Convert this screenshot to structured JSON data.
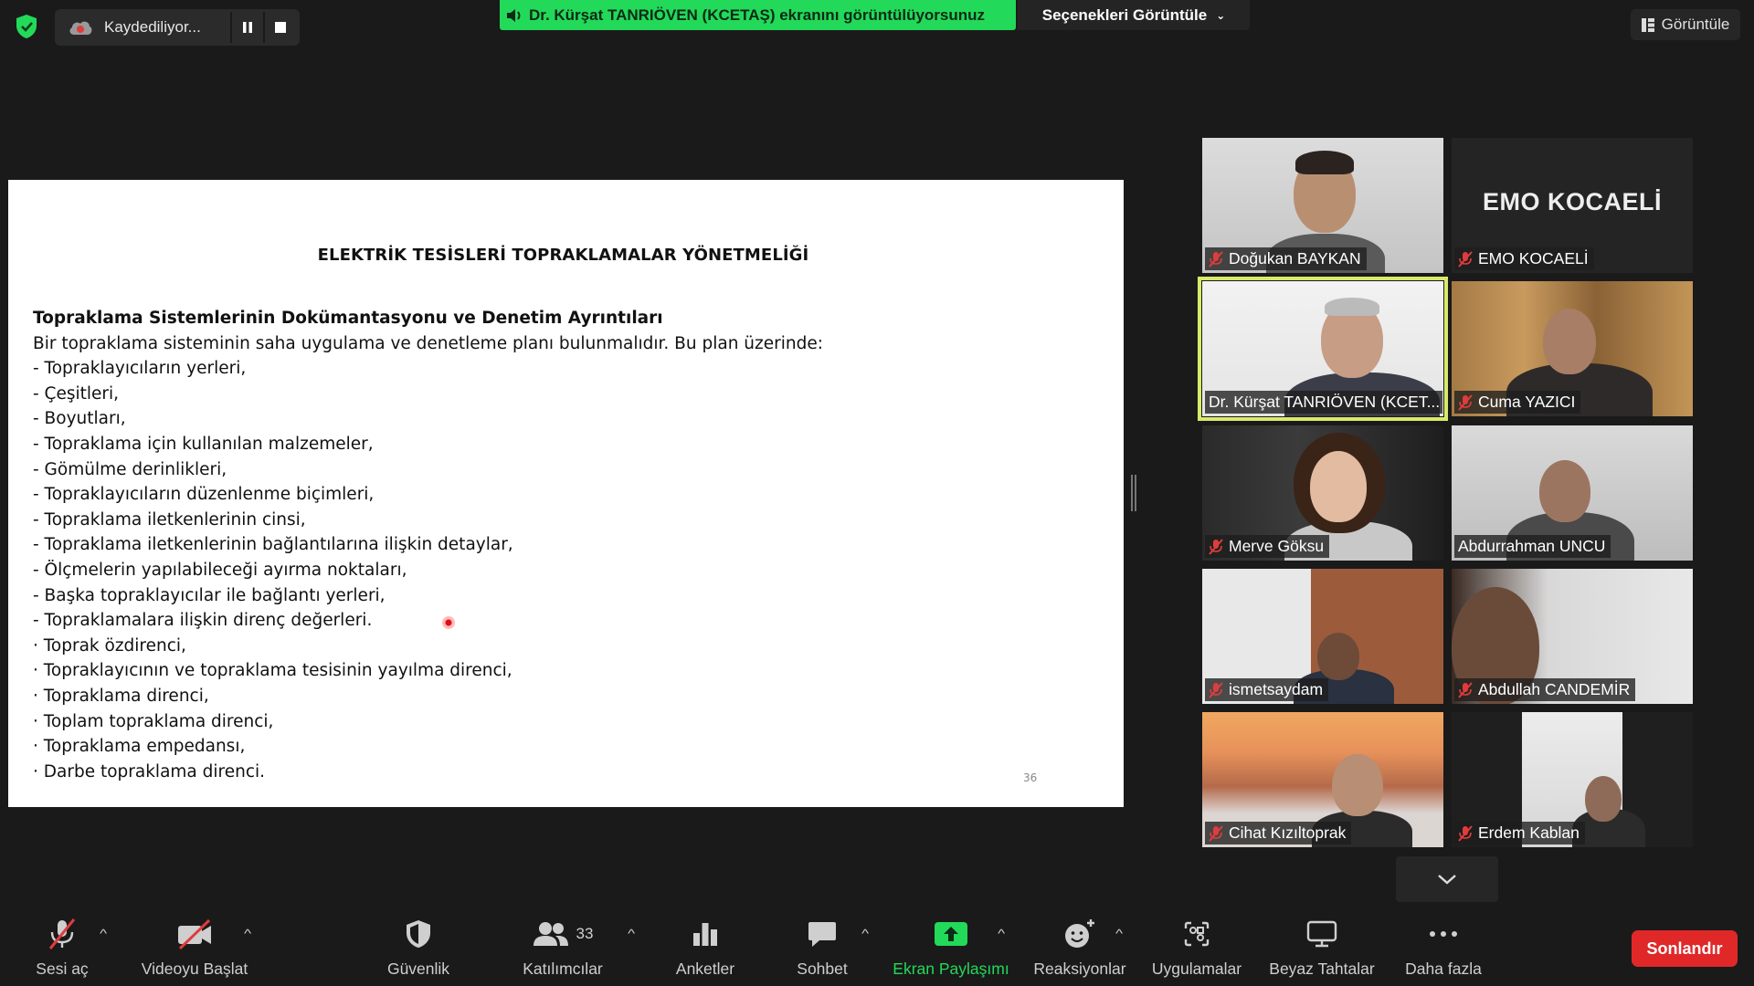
{
  "topbar": {
    "recording_label": "Kaydediliyor...",
    "share_banner": "Dr. Kürşat TANRIÖVEN (KCETAŞ) ekranını görüntülüyorsunuz",
    "view_options_label": "Seçenekleri Görüntüle",
    "view_label": "Görüntüle"
  },
  "slide": {
    "title": "ELEKTRİK TESİSLERİ TOPRAKLAMALAR YÖNETMELİĞİ",
    "heading": "Topraklama Sistemlerinin Dokümantasyonu ve Denetim Ayrıntıları",
    "intro": "Bir topraklama sisteminin saha uygulama ve denetleme planı bulunmalıdır. Bu plan üzerinde:",
    "lines": [
      "- Topraklayıcıların yerleri,",
      "- Çeşitleri,",
      "- Boyutları,",
      "- Topraklama için kullanılan malzemeler,",
      "- Gömülme derinlikleri,",
      "- Topraklayıcıların düzenlenme biçimleri,",
      "- Topraklama iletkenlerinin cinsi,",
      "- Topraklama iletkenlerinin bağlantılarına ilişkin detaylar,",
      "- Ölçmelerin yapılabileceği ayırma noktaları,",
      "- Başka topraklayıcılar ile bağlantı yerleri,",
      "- Topraklamalara ilişkin direnç değerleri.",
      "· Toprak özdirenci,",
      "· Topraklayıcının ve topraklama tesisinin yayılma direnci,",
      "· Topraklama direnci,",
      "· Toplam topraklama direnci,",
      "· Topraklama empedansı,",
      "· Darbe topraklama direnci."
    ],
    "page_number": "36"
  },
  "participants": [
    {
      "name": "Doğukan BAYKAN",
      "muted": true
    },
    {
      "name": "EMO KOCAELİ",
      "muted": true,
      "tile_text": "EMO KOCAELİ"
    },
    {
      "name": "Dr. Kürşat TANRIÖVEN (KCET...",
      "muted": false,
      "active": true
    },
    {
      "name": "Cuma YAZICI",
      "muted": true
    },
    {
      "name": "Merve Göksu",
      "muted": true
    },
    {
      "name": "Abdurrahman UNCU",
      "muted": false
    },
    {
      "name": "ismetsaydam",
      "muted": true
    },
    {
      "name": "Abdullah CANDEMİR",
      "muted": true
    },
    {
      "name": "Cihat Kızıltoprak",
      "muted": true
    },
    {
      "name": "Erdem Kablan",
      "muted": true
    }
  ],
  "toolbar": {
    "unmute": "Sesi aç",
    "start_video": "Videoyu Başlat",
    "security": "Güvenlik",
    "participants": "Katılımcılar",
    "participant_count": "33",
    "polls": "Anketler",
    "chat": "Sohbet",
    "share_screen": "Ekran Paylaşımı",
    "reactions": "Reaksiyonlar",
    "apps": "Uygulamalar",
    "whiteboards": "Beyaz Tahtalar",
    "more": "Daha fazla",
    "end": "Sonlandır"
  },
  "colors": {
    "share_green": "#23d959",
    "end_red": "#e02828",
    "active_speaker": "#d9ea6b",
    "mute_red": "#e03c3c"
  }
}
